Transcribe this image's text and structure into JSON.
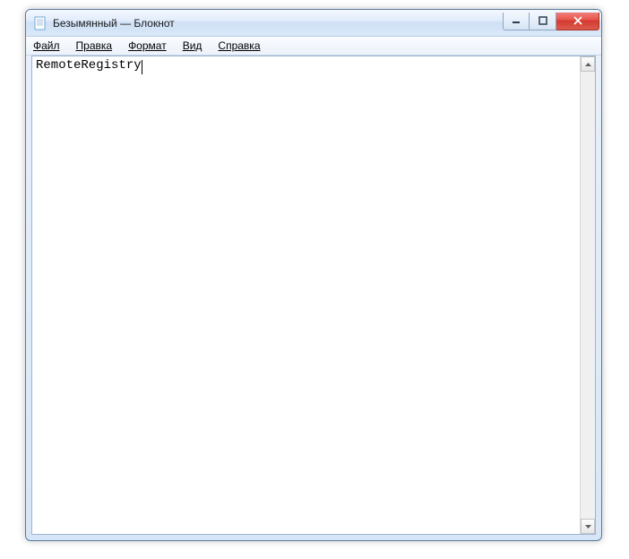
{
  "window": {
    "title": "Безымянный — Блокнот"
  },
  "menubar": {
    "file": "Файл",
    "edit": "Правка",
    "format": "Формат",
    "view": "Вид",
    "help": "Справка"
  },
  "editor": {
    "content": "RemoteRegistry"
  }
}
